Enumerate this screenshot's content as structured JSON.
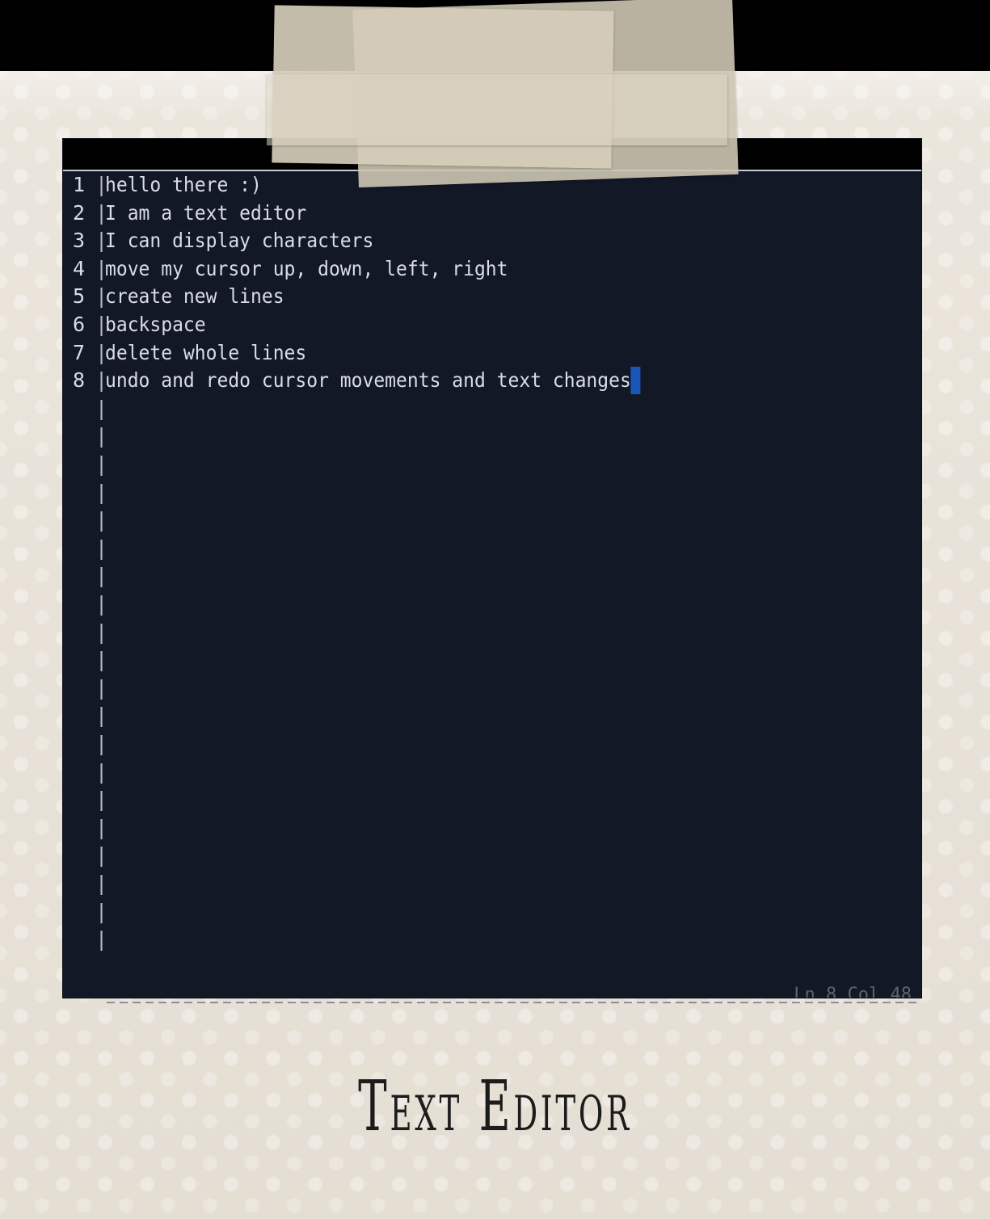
{
  "editor": {
    "lines": [
      {
        "num": "1",
        "text": "hello there :)"
      },
      {
        "num": "2",
        "text": "I am a text editor"
      },
      {
        "num": "3",
        "text": "I can display characters"
      },
      {
        "num": "4",
        "text": "move my cursor up, down, left, right"
      },
      {
        "num": "5",
        "text": "create new lines"
      },
      {
        "num": "6",
        "text": "backspace"
      },
      {
        "num": "7",
        "text": "delete whole lines"
      },
      {
        "num": "8",
        "text": "undo and redo cursor movements and text changes"
      }
    ],
    "empty_gutter_rows": 20,
    "status": "Ln 8 Col 48",
    "cursor_color": "#1a56b8",
    "background_color": "#131826"
  },
  "caption": "Text Editor"
}
